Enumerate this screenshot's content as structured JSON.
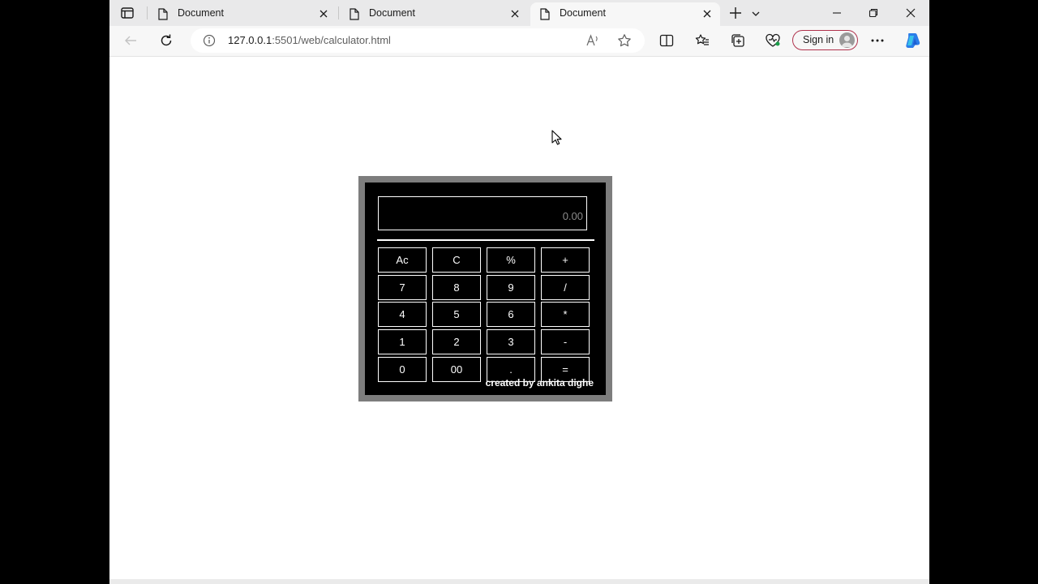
{
  "tabs": [
    {
      "title": "Document"
    },
    {
      "title": "Document"
    },
    {
      "title": "Document"
    }
  ],
  "address": {
    "host": "127.0.0.1",
    "path": ":5501/web/calculator.html"
  },
  "toolbar": {
    "signin_label": "Sign in"
  },
  "calculator": {
    "display_value": "0.00",
    "buttons": [
      [
        "Ac",
        "C",
        "%",
        "+"
      ],
      [
        "7",
        "8",
        "9",
        "/"
      ],
      [
        "4",
        "5",
        "6",
        "*"
      ],
      [
        "1",
        "2",
        "3",
        "-"
      ],
      [
        "0",
        "00",
        ".",
        "="
      ]
    ],
    "credit": "created by ankita dighe"
  }
}
